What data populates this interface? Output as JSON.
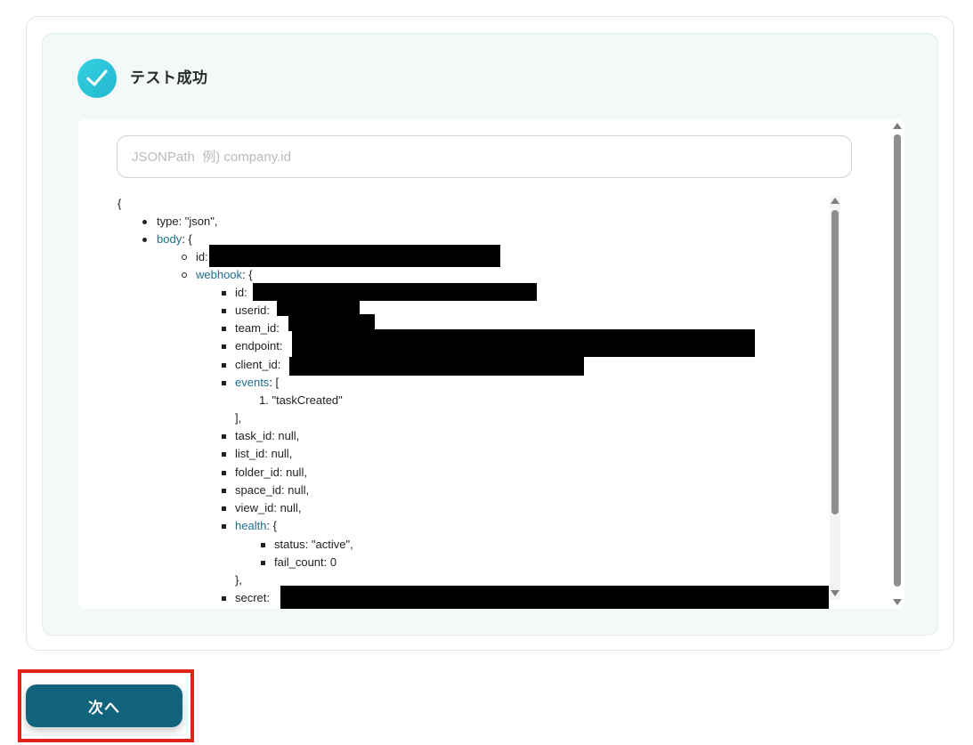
{
  "status": {
    "title": "テスト成功",
    "icon": "check-circle-icon"
  },
  "search": {
    "placeholder": "JSONPath  例) company.id",
    "value": ""
  },
  "tree": {
    "open_brace": "{",
    "type_line": "type: \"json\",",
    "body_key": "body",
    "body_suffix": ": {",
    "id_key": "id:",
    "webhook_key": "webhook",
    "webhook_suffix": ": {",
    "wh_id_key": "id: ",
    "userid_key": "userid:",
    "team_id_key": "team_id:",
    "endpoint_key": "endpoint:",
    "client_id_key": "client_id:",
    "events_key": "events",
    "events_suffix": ": [",
    "event_item": "1. \"taskCreated\"",
    "events_close": "],",
    "task_id": "task_id: null,",
    "list_id": "list_id: null,",
    "folder_id": "folder_id: null,",
    "space_id": "space_id: null,",
    "view_id": "view_id: null,",
    "health_key": "health",
    "health_suffix": ": {",
    "status_line": "status: \"active\",",
    "fail_count_line": "fail_count: 0",
    "health_close": "},",
    "secret_key": "secret:"
  },
  "actions": {
    "next_label": "次へ"
  },
  "colors": {
    "accent": "#12647d",
    "key_link": "#1f6e8c",
    "check": "#2bc3d6",
    "highlight": "#e3221c",
    "panel_bg": "#f3f9f9"
  }
}
